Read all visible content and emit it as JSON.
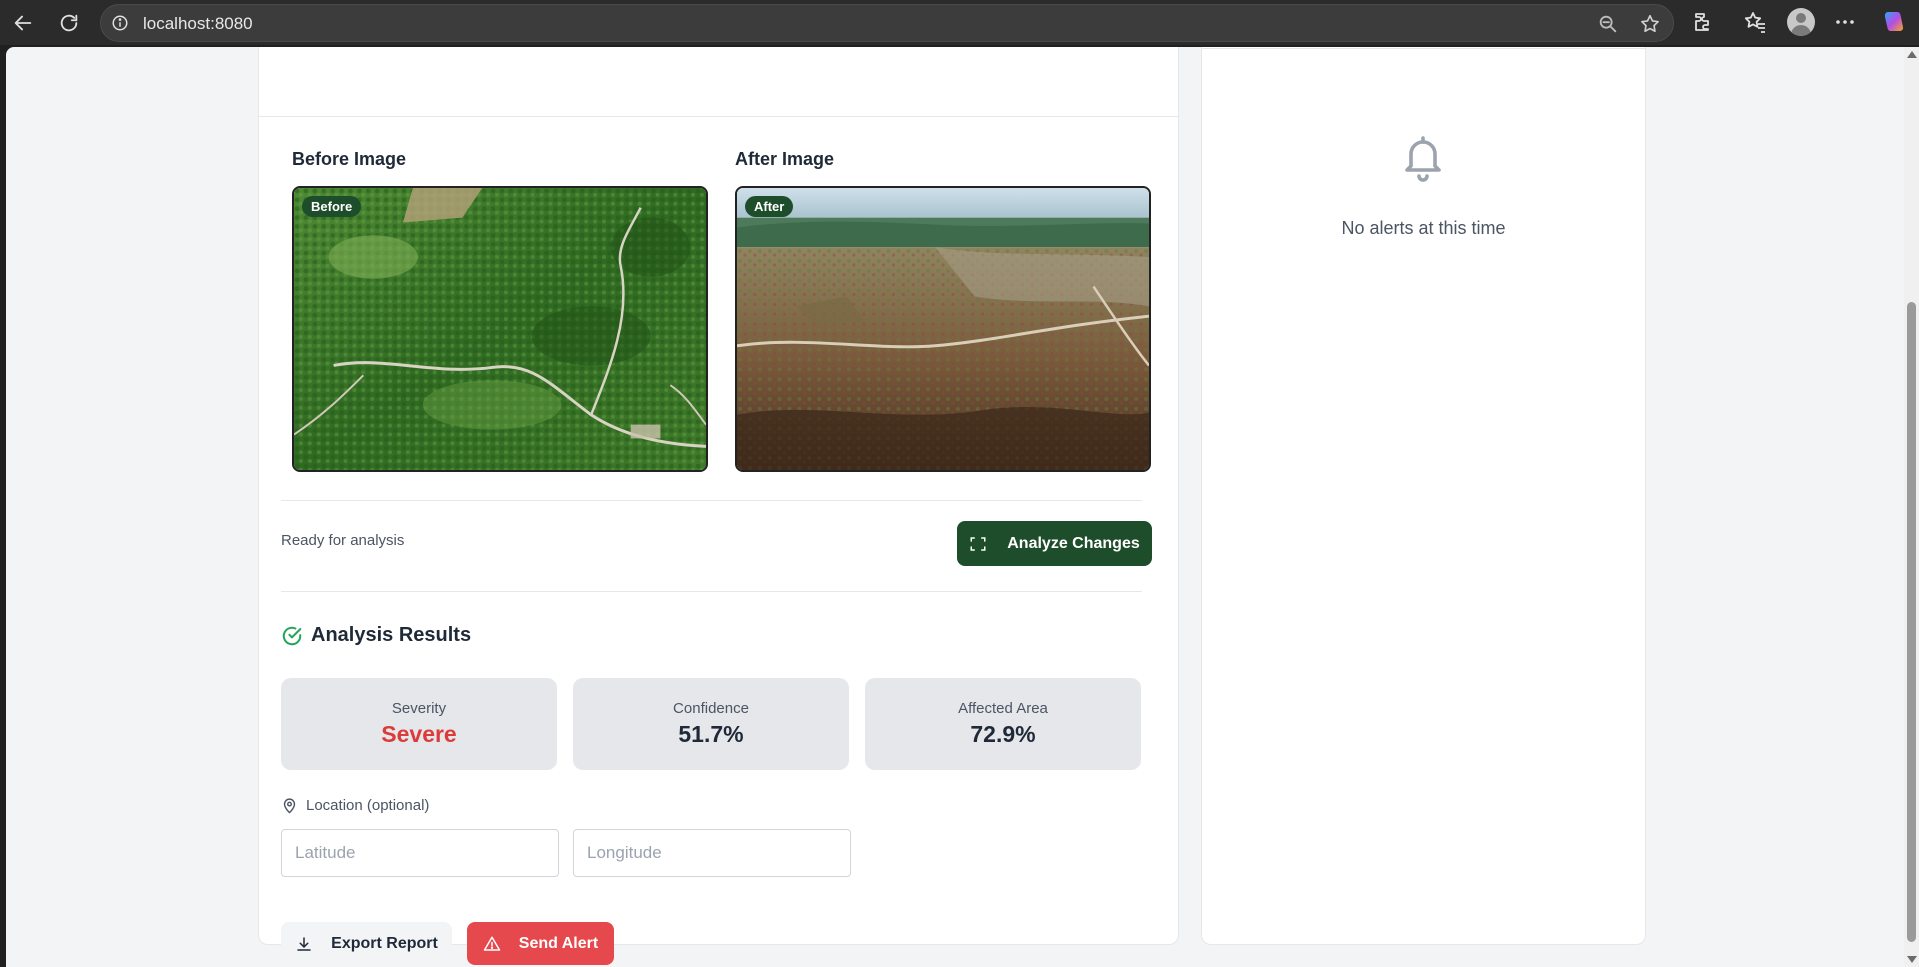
{
  "browser": {
    "url": "localhost:8080",
    "icons": [
      "back-arrow-icon",
      "reload-icon",
      "site-info-icon",
      "zoom-out-icon",
      "favorite-star-icon",
      "extensions-icon",
      "favorites-icon",
      "profile-avatar-icon",
      "more-menu-icon",
      "copilot-icon"
    ]
  },
  "images": {
    "before_heading": "Before Image",
    "before_tag": "Before",
    "after_heading": "After Image",
    "after_tag": "After"
  },
  "analysis": {
    "status": "Ready for analysis",
    "analyze_label": "Analyze Changes",
    "analyze_icon": "scan-icon"
  },
  "results": {
    "title": "Analysis Results",
    "title_icon": "check-circle-icon",
    "metrics": [
      {
        "label": "Severity",
        "value": "Severe",
        "color": "#dc3b3b"
      },
      {
        "label": "Confidence",
        "value": "51.7%"
      },
      {
        "label": "Affected Area",
        "value": "72.9%"
      }
    ]
  },
  "location": {
    "label": "Location (optional)",
    "icon": "map-pin-icon",
    "latitude_placeholder": "Latitude",
    "longitude_placeholder": "Longitude",
    "latitude_value": "",
    "longitude_value": ""
  },
  "actions": {
    "export_label": "Export Report",
    "export_icon": "download-icon",
    "alert_label": "Send Alert",
    "alert_icon": "warning-triangle-icon"
  },
  "alerts_panel": {
    "empty_message": "No alerts at this time",
    "empty_icon": "bell-icon"
  },
  "colors": {
    "primary_green": "#1e4d2b",
    "alert_red": "#e5484d",
    "severe_red": "#dc3b3b",
    "success_green": "#22a55a"
  }
}
